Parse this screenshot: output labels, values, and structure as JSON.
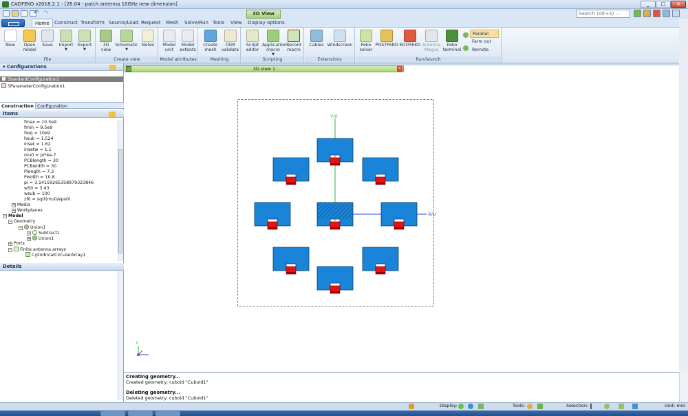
{
  "window": {
    "title": "CADFEKO v2018.2.1 - [26.04 - patch antenna 10GHz new dimension]",
    "min": "_",
    "max": "□",
    "close": "✕"
  },
  "contextual_tab": "3D View",
  "search_placeholder": "Search (Alt+S) ...",
  "tabs": [
    "Home",
    "Construct",
    "Transform",
    "Source/Load",
    "Request",
    "Mesh",
    "Solve/Run",
    "Tools",
    "View",
    "Display options"
  ],
  "ribbon": {
    "file": {
      "label": "File",
      "buttons": [
        "New",
        "Open model",
        "Save",
        "Import",
        "Export"
      ]
    },
    "create_view": {
      "label": "Create view",
      "buttons": [
        "3D view",
        "Schematic",
        "Notes"
      ]
    },
    "model_attributes": {
      "label": "Model attributes",
      "buttons": [
        "Model unit",
        "Model extents"
      ]
    },
    "meshing": {
      "label": "Meshing",
      "buttons": [
        "Create mesh",
        "CEM validate"
      ]
    },
    "scripting": {
      "label": "Scripting",
      "buttons": [
        "Script editor",
        "Application macro",
        "Record macro"
      ]
    },
    "extensions": {
      "label": "Extensions",
      "buttons": [
        "Cables",
        "Windscreen"
      ]
    },
    "run_launch": {
      "label": "Run/launch",
      "buttons": [
        "Feko solver",
        "POSTFEKO",
        "EDITFEKO",
        "Antenna Magus",
        "Feko terminal"
      ],
      "options": [
        "Parallel",
        "Farm out",
        "Remote"
      ]
    }
  },
  "configurations": {
    "header": "Configurations",
    "items": [
      "StandardConfiguration1",
      "SParameterConfiguration1"
    ]
  },
  "subtabs": [
    "Construction",
    "Configuration"
  ],
  "items_header": "Items",
  "variables": [
    "fmax = 10.5e9",
    "fmin = 9.5e9",
    "freq = 10e9",
    "hsub = 1.524",
    "inset = 1.62",
    "insetw = 1.1",
    "mu0 = pi*4e-7",
    "PCBlength = 30",
    "PCBwidth = 30",
    "Plength = 7.3",
    "Pwidth = 10.8",
    "pi = 3.14159265358979323846",
    "w50 = 3.43",
    "wsub = 100",
    "zf0 = sqrt(mu0/eps0)"
  ],
  "tree": {
    "media": "Media",
    "workplanes": "Workplanes",
    "model": "Model",
    "geometry": "Geometry",
    "union1": "Union1",
    "subtract1": "Subtract1",
    "union1_child": "Union1",
    "ports": "Ports",
    "finite_arrays": "Finite antenna arrays",
    "array": "CylindricalCircularArray1"
  },
  "details_header": "Details",
  "view_tab": "3D view 1",
  "axes": {
    "y_label": "Y/V",
    "x_label": "X/U",
    "mini_y": "Y"
  },
  "messages": [
    {
      "title": "Creating geometry...",
      "detail": "Created geometry: cuboid \"Cuboid1\""
    },
    {
      "title": "Deleting geometry...",
      "detail": "Deleted geometry: cuboid \"Cuboid1\""
    }
  ],
  "status": {
    "display": "Display:",
    "tools": "Tools:",
    "selection": "Selection:",
    "unit": "Unit: mm"
  },
  "colors": {
    "patch": "#1a84d8",
    "feed": "#e81010",
    "axis_y": "#2db82d",
    "axis_x": "#2b3fd0"
  }
}
